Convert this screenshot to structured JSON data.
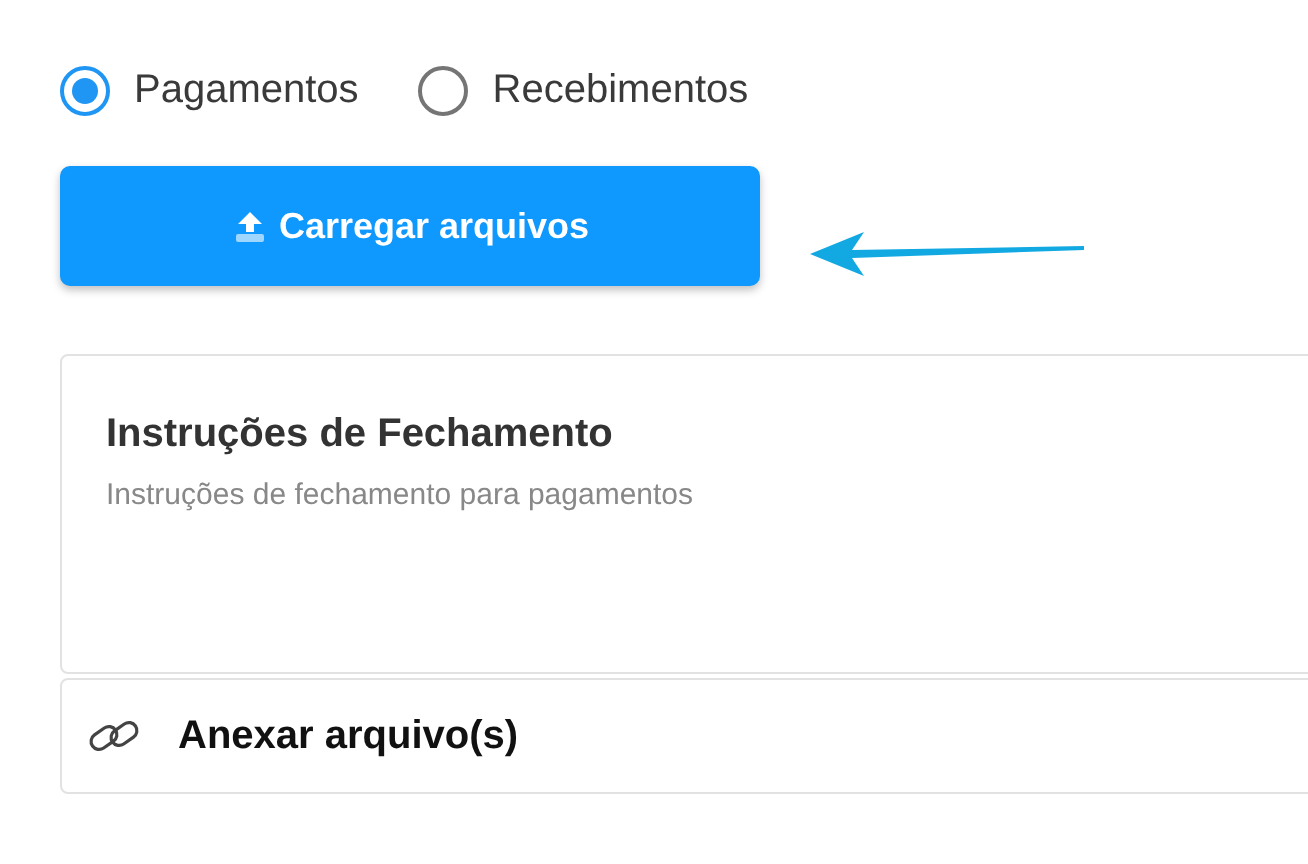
{
  "radios": [
    {
      "label": "Pagamentos",
      "selected": true
    },
    {
      "label": "Recebimentos",
      "selected": false
    }
  ],
  "upload_button": {
    "label": "Carregar arquivos"
  },
  "instructions": {
    "title": "Instruções de Fechamento",
    "subtitle": "Instruções de fechamento para pagamentos"
  },
  "attach": {
    "label": "Anexar arquivo(s)"
  }
}
